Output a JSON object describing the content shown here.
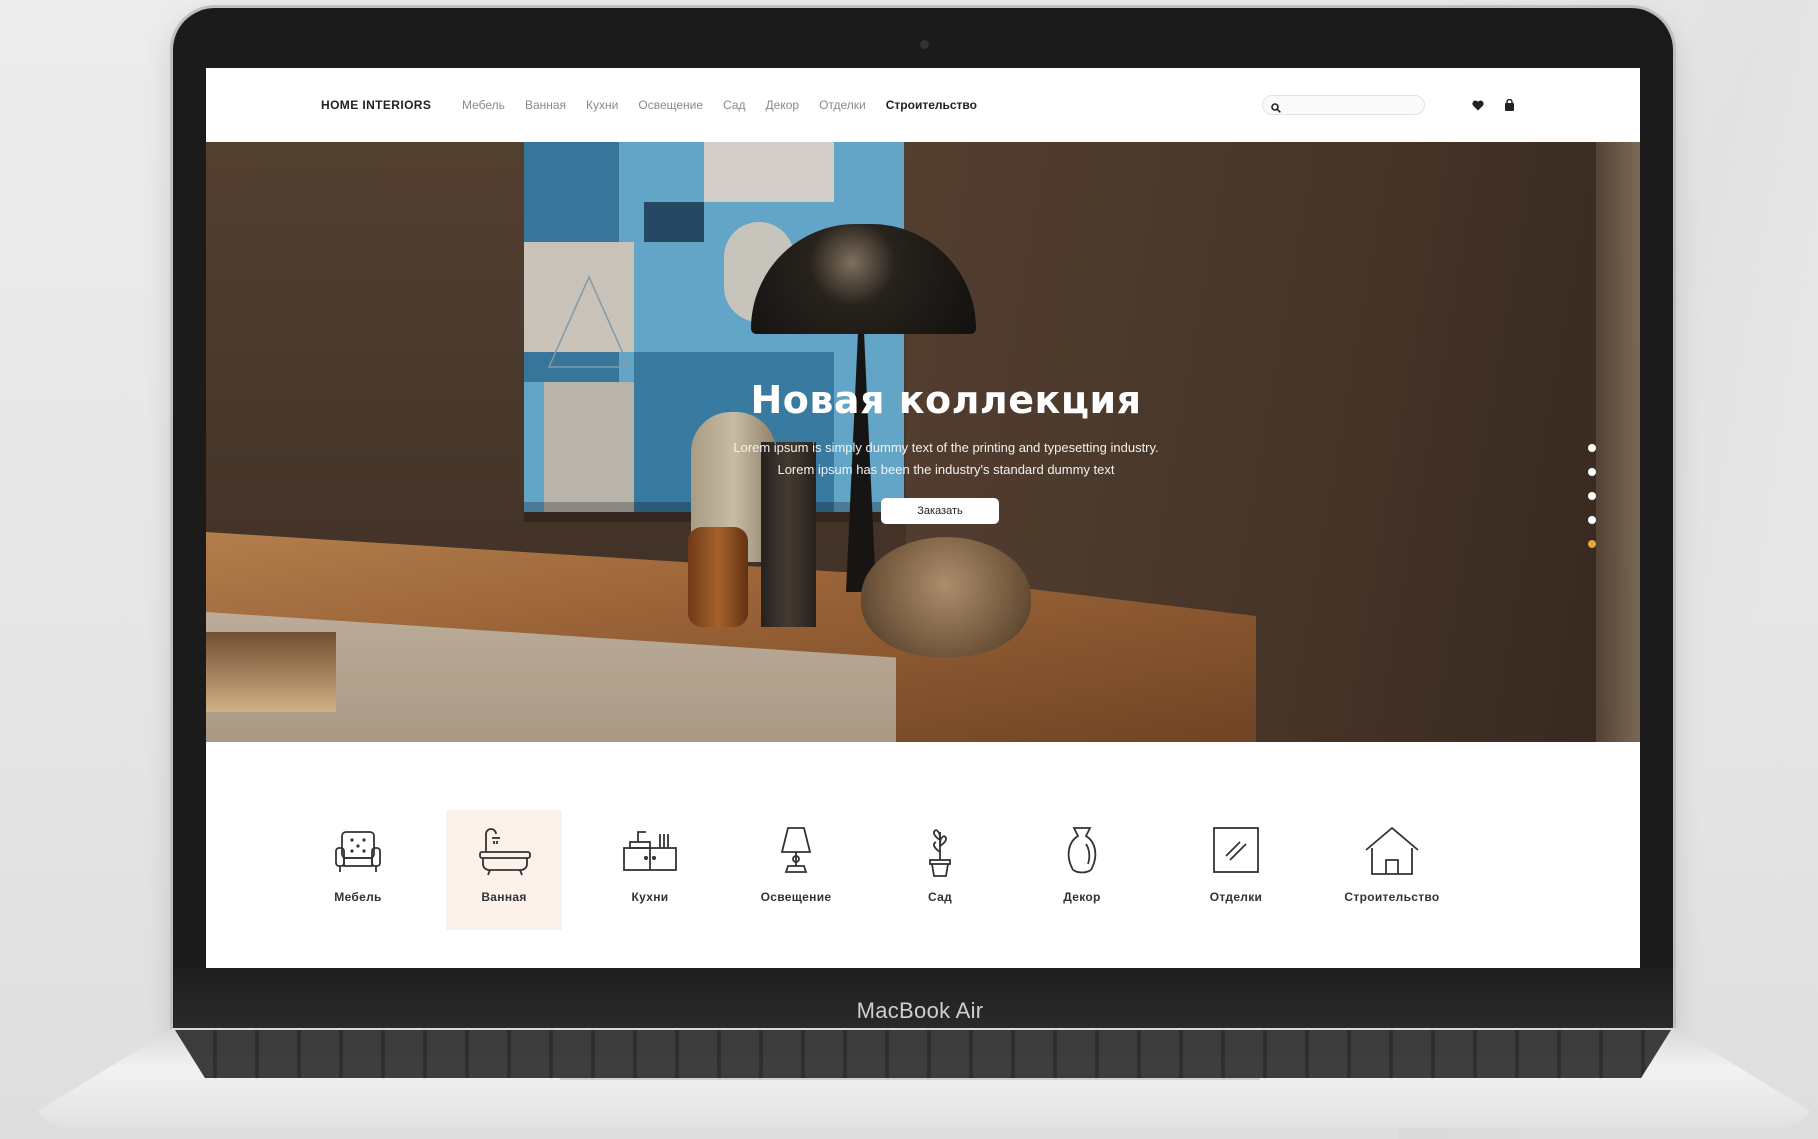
{
  "device": {
    "brand_label": "MacBook Air"
  },
  "header": {
    "logo": "HOME INTERIORS",
    "nav": [
      {
        "label": "Мебель"
      },
      {
        "label": "Ванная"
      },
      {
        "label": "Кухни"
      },
      {
        "label": "Освещение"
      },
      {
        "label": "Сад"
      },
      {
        "label": "Декор"
      },
      {
        "label": "Отделки"
      },
      {
        "label": "Строительство",
        "active": true
      }
    ],
    "search": {
      "placeholder": "",
      "value": ""
    },
    "icons": [
      "heart-icon",
      "shopping-bag-icon"
    ]
  },
  "hero": {
    "title": "Новая коллекция",
    "text_line1": "Lorem ipsum is simply dummy text of the printing and typesetting industry.",
    "text_line2": "Lorem ipsum has been the industry's standard dummy text",
    "cta_label": "Заказать",
    "slides_total": 5,
    "active_slide": 5,
    "accent_color": "#e8a23a"
  },
  "categories": [
    {
      "label": "Мебель",
      "icon": "armchair-icon"
    },
    {
      "label": "Ванная",
      "icon": "bathtub-icon",
      "active": true
    },
    {
      "label": "Кухни",
      "icon": "kitchen-sink-icon"
    },
    {
      "label": "Освещение",
      "icon": "table-lamp-icon"
    },
    {
      "label": "Сад",
      "icon": "potted-plant-icon"
    },
    {
      "label": "Декор",
      "icon": "vase-icon"
    },
    {
      "label": "Отделки",
      "icon": "glass-panel-icon"
    },
    {
      "label": "Строительство",
      "icon": "house-icon"
    }
  ],
  "colors": {
    "active_category_bg": "#fcf2ea",
    "text_dark": "#222222",
    "nav_muted": "#8a8a8a"
  }
}
